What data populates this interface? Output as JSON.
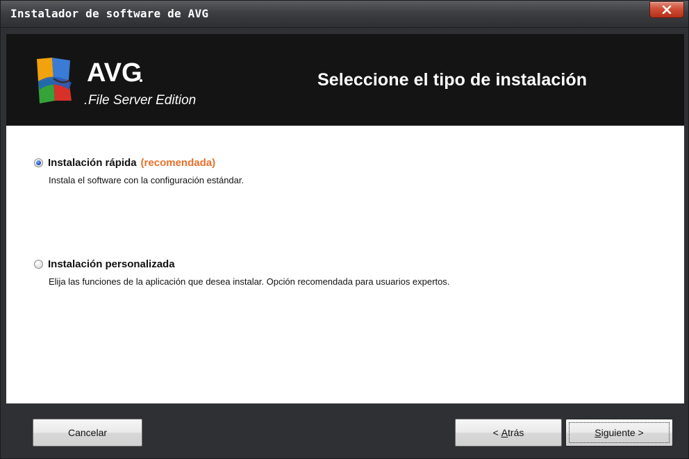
{
  "window": {
    "title": "Instalador de software de AVG",
    "close_icon": "close-x-icon"
  },
  "header": {
    "logo_brand": "AVG",
    "logo_edition": "File Server Edition",
    "title": "Seleccione el tipo de instalación"
  },
  "options": [
    {
      "label": "Instalación rápida",
      "tag": "(recomendada)",
      "description": "Instala el software con la configuración estándar.",
      "selected": true
    },
    {
      "label": "Instalación personalizada",
      "tag": "",
      "description": "Elija las funciones de la aplicación que desea instalar. Opción recomendada para usuarios expertos.",
      "selected": false
    }
  ],
  "buttons": {
    "cancel": "Cancelar",
    "back_prefix": "< ",
    "back_accel": "A",
    "back_rest": "trás",
    "next_accel": "S",
    "next_rest": "iguiente >"
  },
  "colors": {
    "accent_orange": "#e8702a",
    "header_bg": "#141414",
    "frame_bg": "#2f3033",
    "close_red": "#cf4d35"
  }
}
